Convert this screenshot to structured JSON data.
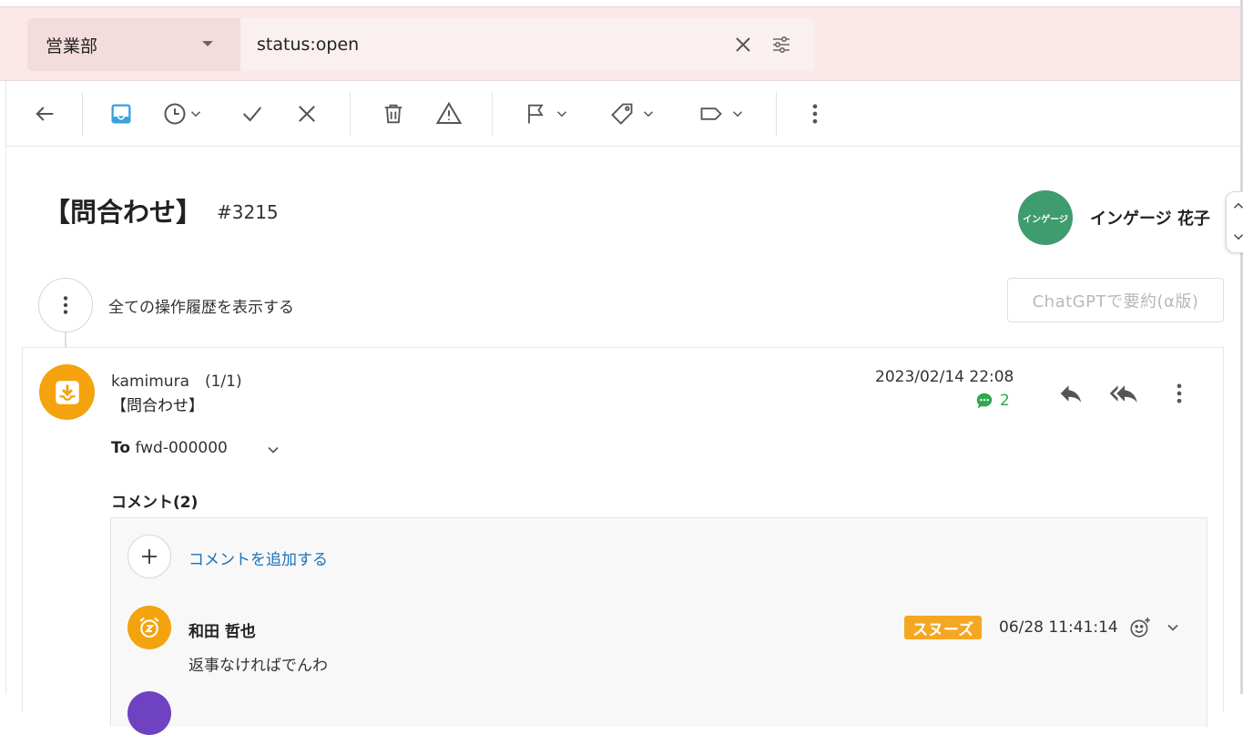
{
  "filter": {
    "department": "営業部",
    "query": "status:open"
  },
  "ticket": {
    "title": "【問合わせ】",
    "number": "#3215",
    "assignee_avatar_text": "インゲージ",
    "assignee_name": "インゲージ 花子"
  },
  "history": {
    "label": "全ての操作履歴を表示する"
  },
  "chatgpt": {
    "label": "ChatGPTで要約(α版)"
  },
  "message": {
    "sender": "kamimura　(1/1)",
    "subject": "【問合わせ】",
    "date": "2023/02/14 22:08",
    "comment_count": "2",
    "to_label": "To",
    "to_value": "fwd-000000",
    "comments_heading": "コメント(2)"
  },
  "comments": {
    "add_label": "コメントを追加する",
    "items": [
      {
        "author": "和田 哲也",
        "badge": "スヌーズ",
        "time": "06/28 11:41:14",
        "text": "返事なければでんわ"
      }
    ]
  },
  "colors": {
    "filter_bg": "#fde8e9",
    "accent_blue": "#1d72b8",
    "inbox_icon": "#3aa0e0",
    "avatar_orange": "#f4a20d",
    "assignee_green": "#3f9c6e",
    "comment_green": "#2fa84f",
    "snooze_orange": "#f5a623"
  }
}
